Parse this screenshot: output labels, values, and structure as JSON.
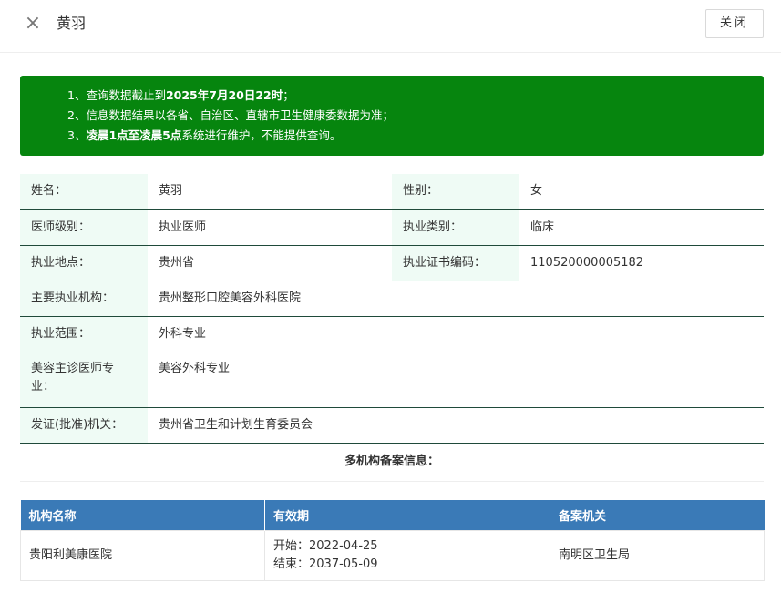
{
  "header": {
    "close_icon": "×",
    "title": "黄羽",
    "close_label": "关闭"
  },
  "notice": {
    "line1_prefix": "1、查询数据截止到",
    "line1_bold": "2025年7月20日22时",
    "line1_suffix": "；",
    "line2": "2、信息数据结果以各省、自治区、直辖市卫生健康委数据为准；",
    "line3_prefix": "3、",
    "line3_bold": "凌晨1点至凌晨5点",
    "line3_suffix": "系统进行维护，不能提供查询。",
    "bg_color": "#06850e"
  },
  "info": {
    "name_label": "姓名：",
    "name_value": "黄羽",
    "gender_label": "性别：",
    "gender_value": "女",
    "level_label": "医师级别：",
    "level_value": "执业医师",
    "category_label": "执业类别：",
    "category_value": "临床",
    "location_label": "执业地点：",
    "location_value": "贵州省",
    "cert_label": "执业证书编码：",
    "cert_value": "110520000005182",
    "institution_label": "主要执业机构：",
    "institution_value": "贵州整形口腔美容外科医院",
    "scope_label": "执业范围：",
    "scope_value": "外科专业",
    "cosmetic_label": "美容主诊医师专业：",
    "cosmetic_value": "美容外科专业",
    "issuer_label": "发证(批准)机关：",
    "issuer_value": "贵州省卫生和计划生育委员会"
  },
  "multi_org": {
    "title": "多机构备案信息：",
    "columns": [
      "机构名称",
      "有效期",
      "备案机关"
    ],
    "header_color": "#3a7ab7",
    "rows": [
      {
        "name": "贵阳利美康医院",
        "start": "开始：2022-04-25",
        "end": "结束：2037-05-09",
        "authority": "南明区卫生局"
      }
    ]
  }
}
